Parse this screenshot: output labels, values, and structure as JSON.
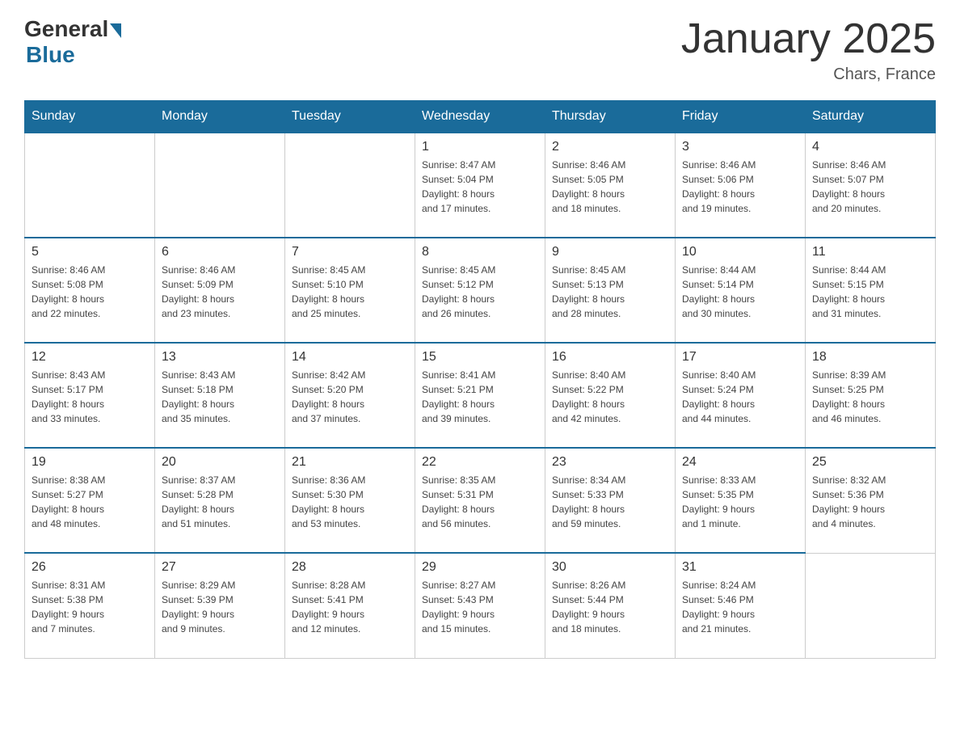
{
  "header": {
    "logo": {
      "general_text": "General",
      "blue_text": "Blue"
    },
    "title": "January 2025",
    "location": "Chars, France"
  },
  "weekdays": [
    "Sunday",
    "Monday",
    "Tuesday",
    "Wednesday",
    "Thursday",
    "Friday",
    "Saturday"
  ],
  "weeks": [
    [
      {
        "day": "",
        "info": ""
      },
      {
        "day": "",
        "info": ""
      },
      {
        "day": "",
        "info": ""
      },
      {
        "day": "1",
        "info": "Sunrise: 8:47 AM\nSunset: 5:04 PM\nDaylight: 8 hours\nand 17 minutes."
      },
      {
        "day": "2",
        "info": "Sunrise: 8:46 AM\nSunset: 5:05 PM\nDaylight: 8 hours\nand 18 minutes."
      },
      {
        "day": "3",
        "info": "Sunrise: 8:46 AM\nSunset: 5:06 PM\nDaylight: 8 hours\nand 19 minutes."
      },
      {
        "day": "4",
        "info": "Sunrise: 8:46 AM\nSunset: 5:07 PM\nDaylight: 8 hours\nand 20 minutes."
      }
    ],
    [
      {
        "day": "5",
        "info": "Sunrise: 8:46 AM\nSunset: 5:08 PM\nDaylight: 8 hours\nand 22 minutes."
      },
      {
        "day": "6",
        "info": "Sunrise: 8:46 AM\nSunset: 5:09 PM\nDaylight: 8 hours\nand 23 minutes."
      },
      {
        "day": "7",
        "info": "Sunrise: 8:45 AM\nSunset: 5:10 PM\nDaylight: 8 hours\nand 25 minutes."
      },
      {
        "day": "8",
        "info": "Sunrise: 8:45 AM\nSunset: 5:12 PM\nDaylight: 8 hours\nand 26 minutes."
      },
      {
        "day": "9",
        "info": "Sunrise: 8:45 AM\nSunset: 5:13 PM\nDaylight: 8 hours\nand 28 minutes."
      },
      {
        "day": "10",
        "info": "Sunrise: 8:44 AM\nSunset: 5:14 PM\nDaylight: 8 hours\nand 30 minutes."
      },
      {
        "day": "11",
        "info": "Sunrise: 8:44 AM\nSunset: 5:15 PM\nDaylight: 8 hours\nand 31 minutes."
      }
    ],
    [
      {
        "day": "12",
        "info": "Sunrise: 8:43 AM\nSunset: 5:17 PM\nDaylight: 8 hours\nand 33 minutes."
      },
      {
        "day": "13",
        "info": "Sunrise: 8:43 AM\nSunset: 5:18 PM\nDaylight: 8 hours\nand 35 minutes."
      },
      {
        "day": "14",
        "info": "Sunrise: 8:42 AM\nSunset: 5:20 PM\nDaylight: 8 hours\nand 37 minutes."
      },
      {
        "day": "15",
        "info": "Sunrise: 8:41 AM\nSunset: 5:21 PM\nDaylight: 8 hours\nand 39 minutes."
      },
      {
        "day": "16",
        "info": "Sunrise: 8:40 AM\nSunset: 5:22 PM\nDaylight: 8 hours\nand 42 minutes."
      },
      {
        "day": "17",
        "info": "Sunrise: 8:40 AM\nSunset: 5:24 PM\nDaylight: 8 hours\nand 44 minutes."
      },
      {
        "day": "18",
        "info": "Sunrise: 8:39 AM\nSunset: 5:25 PM\nDaylight: 8 hours\nand 46 minutes."
      }
    ],
    [
      {
        "day": "19",
        "info": "Sunrise: 8:38 AM\nSunset: 5:27 PM\nDaylight: 8 hours\nand 48 minutes."
      },
      {
        "day": "20",
        "info": "Sunrise: 8:37 AM\nSunset: 5:28 PM\nDaylight: 8 hours\nand 51 minutes."
      },
      {
        "day": "21",
        "info": "Sunrise: 8:36 AM\nSunset: 5:30 PM\nDaylight: 8 hours\nand 53 minutes."
      },
      {
        "day": "22",
        "info": "Sunrise: 8:35 AM\nSunset: 5:31 PM\nDaylight: 8 hours\nand 56 minutes."
      },
      {
        "day": "23",
        "info": "Sunrise: 8:34 AM\nSunset: 5:33 PM\nDaylight: 8 hours\nand 59 minutes."
      },
      {
        "day": "24",
        "info": "Sunrise: 8:33 AM\nSunset: 5:35 PM\nDaylight: 9 hours\nand 1 minute."
      },
      {
        "day": "25",
        "info": "Sunrise: 8:32 AM\nSunset: 5:36 PM\nDaylight: 9 hours\nand 4 minutes."
      }
    ],
    [
      {
        "day": "26",
        "info": "Sunrise: 8:31 AM\nSunset: 5:38 PM\nDaylight: 9 hours\nand 7 minutes."
      },
      {
        "day": "27",
        "info": "Sunrise: 8:29 AM\nSunset: 5:39 PM\nDaylight: 9 hours\nand 9 minutes."
      },
      {
        "day": "28",
        "info": "Sunrise: 8:28 AM\nSunset: 5:41 PM\nDaylight: 9 hours\nand 12 minutes."
      },
      {
        "day": "29",
        "info": "Sunrise: 8:27 AM\nSunset: 5:43 PM\nDaylight: 9 hours\nand 15 minutes."
      },
      {
        "day": "30",
        "info": "Sunrise: 8:26 AM\nSunset: 5:44 PM\nDaylight: 9 hours\nand 18 minutes."
      },
      {
        "day": "31",
        "info": "Sunrise: 8:24 AM\nSunset: 5:46 PM\nDaylight: 9 hours\nand 21 minutes."
      },
      {
        "day": "",
        "info": ""
      }
    ]
  ]
}
